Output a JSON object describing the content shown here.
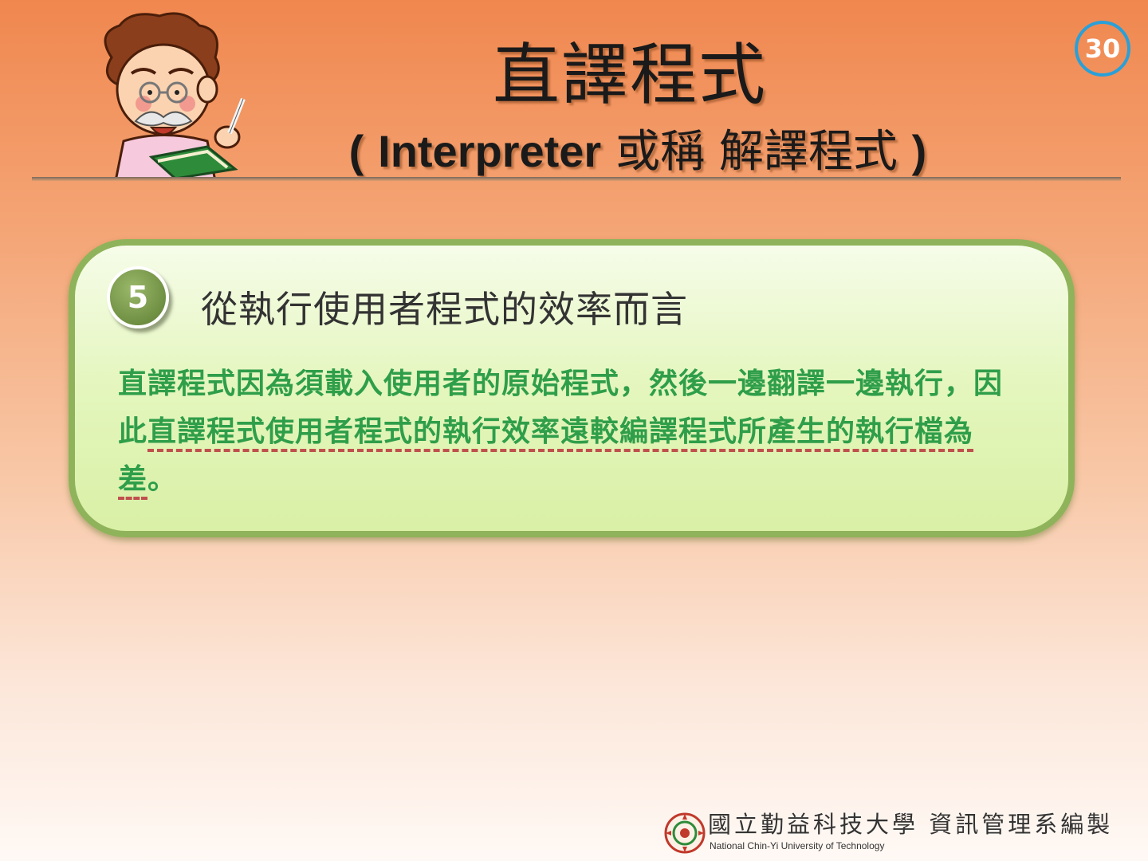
{
  "slide": {
    "page_number": "30",
    "title": "直譯程式",
    "subtitle": {
      "open": "(",
      "english": "Interpreter",
      "middle": "或稱",
      "chinese": "解譯程式",
      "close": ")"
    }
  },
  "card": {
    "badge": "5",
    "heading": "從執行使用者程式的效率而言",
    "body": {
      "part1": "直譯程式因為須載入使用者的原始程式，然後一邊翻譯一邊執行，因此",
      "highlighted": "直譯程式使用者程式的執行效率遠較編譯程式所產生的執行檔為差",
      "end": "。"
    }
  },
  "footer": {
    "university_cn": "國立勤益科技大學",
    "department_cn": "資訊管理系編製",
    "university_en": "National Chin-Yi University of Technology"
  },
  "colors": {
    "accent_green": "#2f9e4a",
    "card_border": "#8fb35a",
    "page_number_ring": "#2aa0d8",
    "underline_red": "#c0504d"
  },
  "icons": {
    "mascot": "professor-reading-book-illustration",
    "badge": "numbered-circle-badge",
    "seal": "university-seal-logo"
  }
}
